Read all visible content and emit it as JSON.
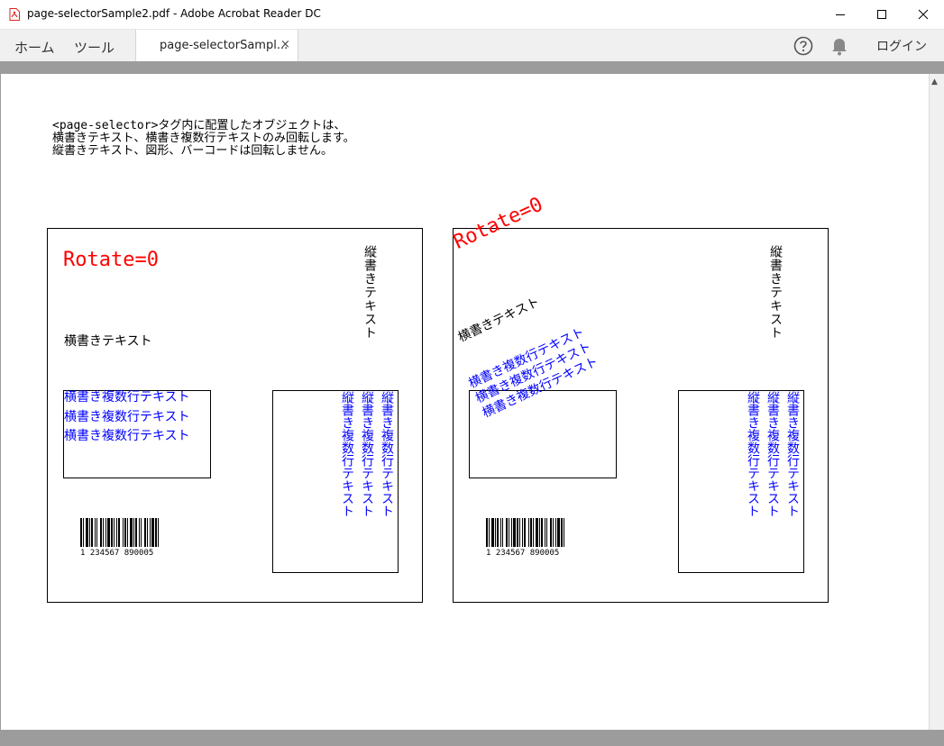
{
  "window": {
    "title": "page-selectorSample2.pdf - Adobe Acrobat Reader DC",
    "minimize_icon": "minimize-icon",
    "maximize_icon": "maximize-icon",
    "close_icon": "close-icon"
  },
  "menubar": {
    "home": "ホーム",
    "tools": "ツール",
    "doc_tab_label": "page-selectorSampl...",
    "doc_tab_close": "×",
    "help_icon": "help-icon",
    "bell_icon": "bell-icon",
    "login": "ログイン"
  },
  "document": {
    "intro_lines": [
      "<page-selector>タグ内に配置したオブジェクトは、",
      "横書きテキスト、横書き複数行テキストのみ回転します。",
      "縦書きテキスト、図形、バーコードは回転しません。"
    ],
    "panels": [
      {
        "rotate_label": "Rotate=0",
        "horizontal_text": "横書きテキスト",
        "vertical_text": "縦書きテキスト",
        "multiline_horizontal": [
          "横書き複数行テキスト",
          "横書き複数行テキスト",
          "横書き複数行テキスト"
        ],
        "multiline_vertical": [
          "縦書き複数行テキスト",
          "縦書き複数行テキスト",
          "縦書き複数行テキスト"
        ],
        "barcode_digits": "1 234567 890005",
        "rotation_deg": 0
      },
      {
        "rotate_label": "Rotate=0",
        "horizontal_text": "横書きテキスト",
        "vertical_text": "縦書きテキスト",
        "multiline_horizontal": [
          "横書き複数行テキスト",
          "横書き複数行テキスト",
          "横書き複数行テキスト"
        ],
        "multiline_vertical": [
          "縦書き複数行テキスト",
          "縦書き複数行テキスト",
          "縦書き複数行テキスト"
        ],
        "barcode_digits": "1 234567 890005",
        "rotation_deg": -25
      }
    ]
  },
  "colors": {
    "rotate_label": "#ff0000",
    "multiline_text": "#0000ff",
    "pdf_icon": "#d9261c"
  }
}
